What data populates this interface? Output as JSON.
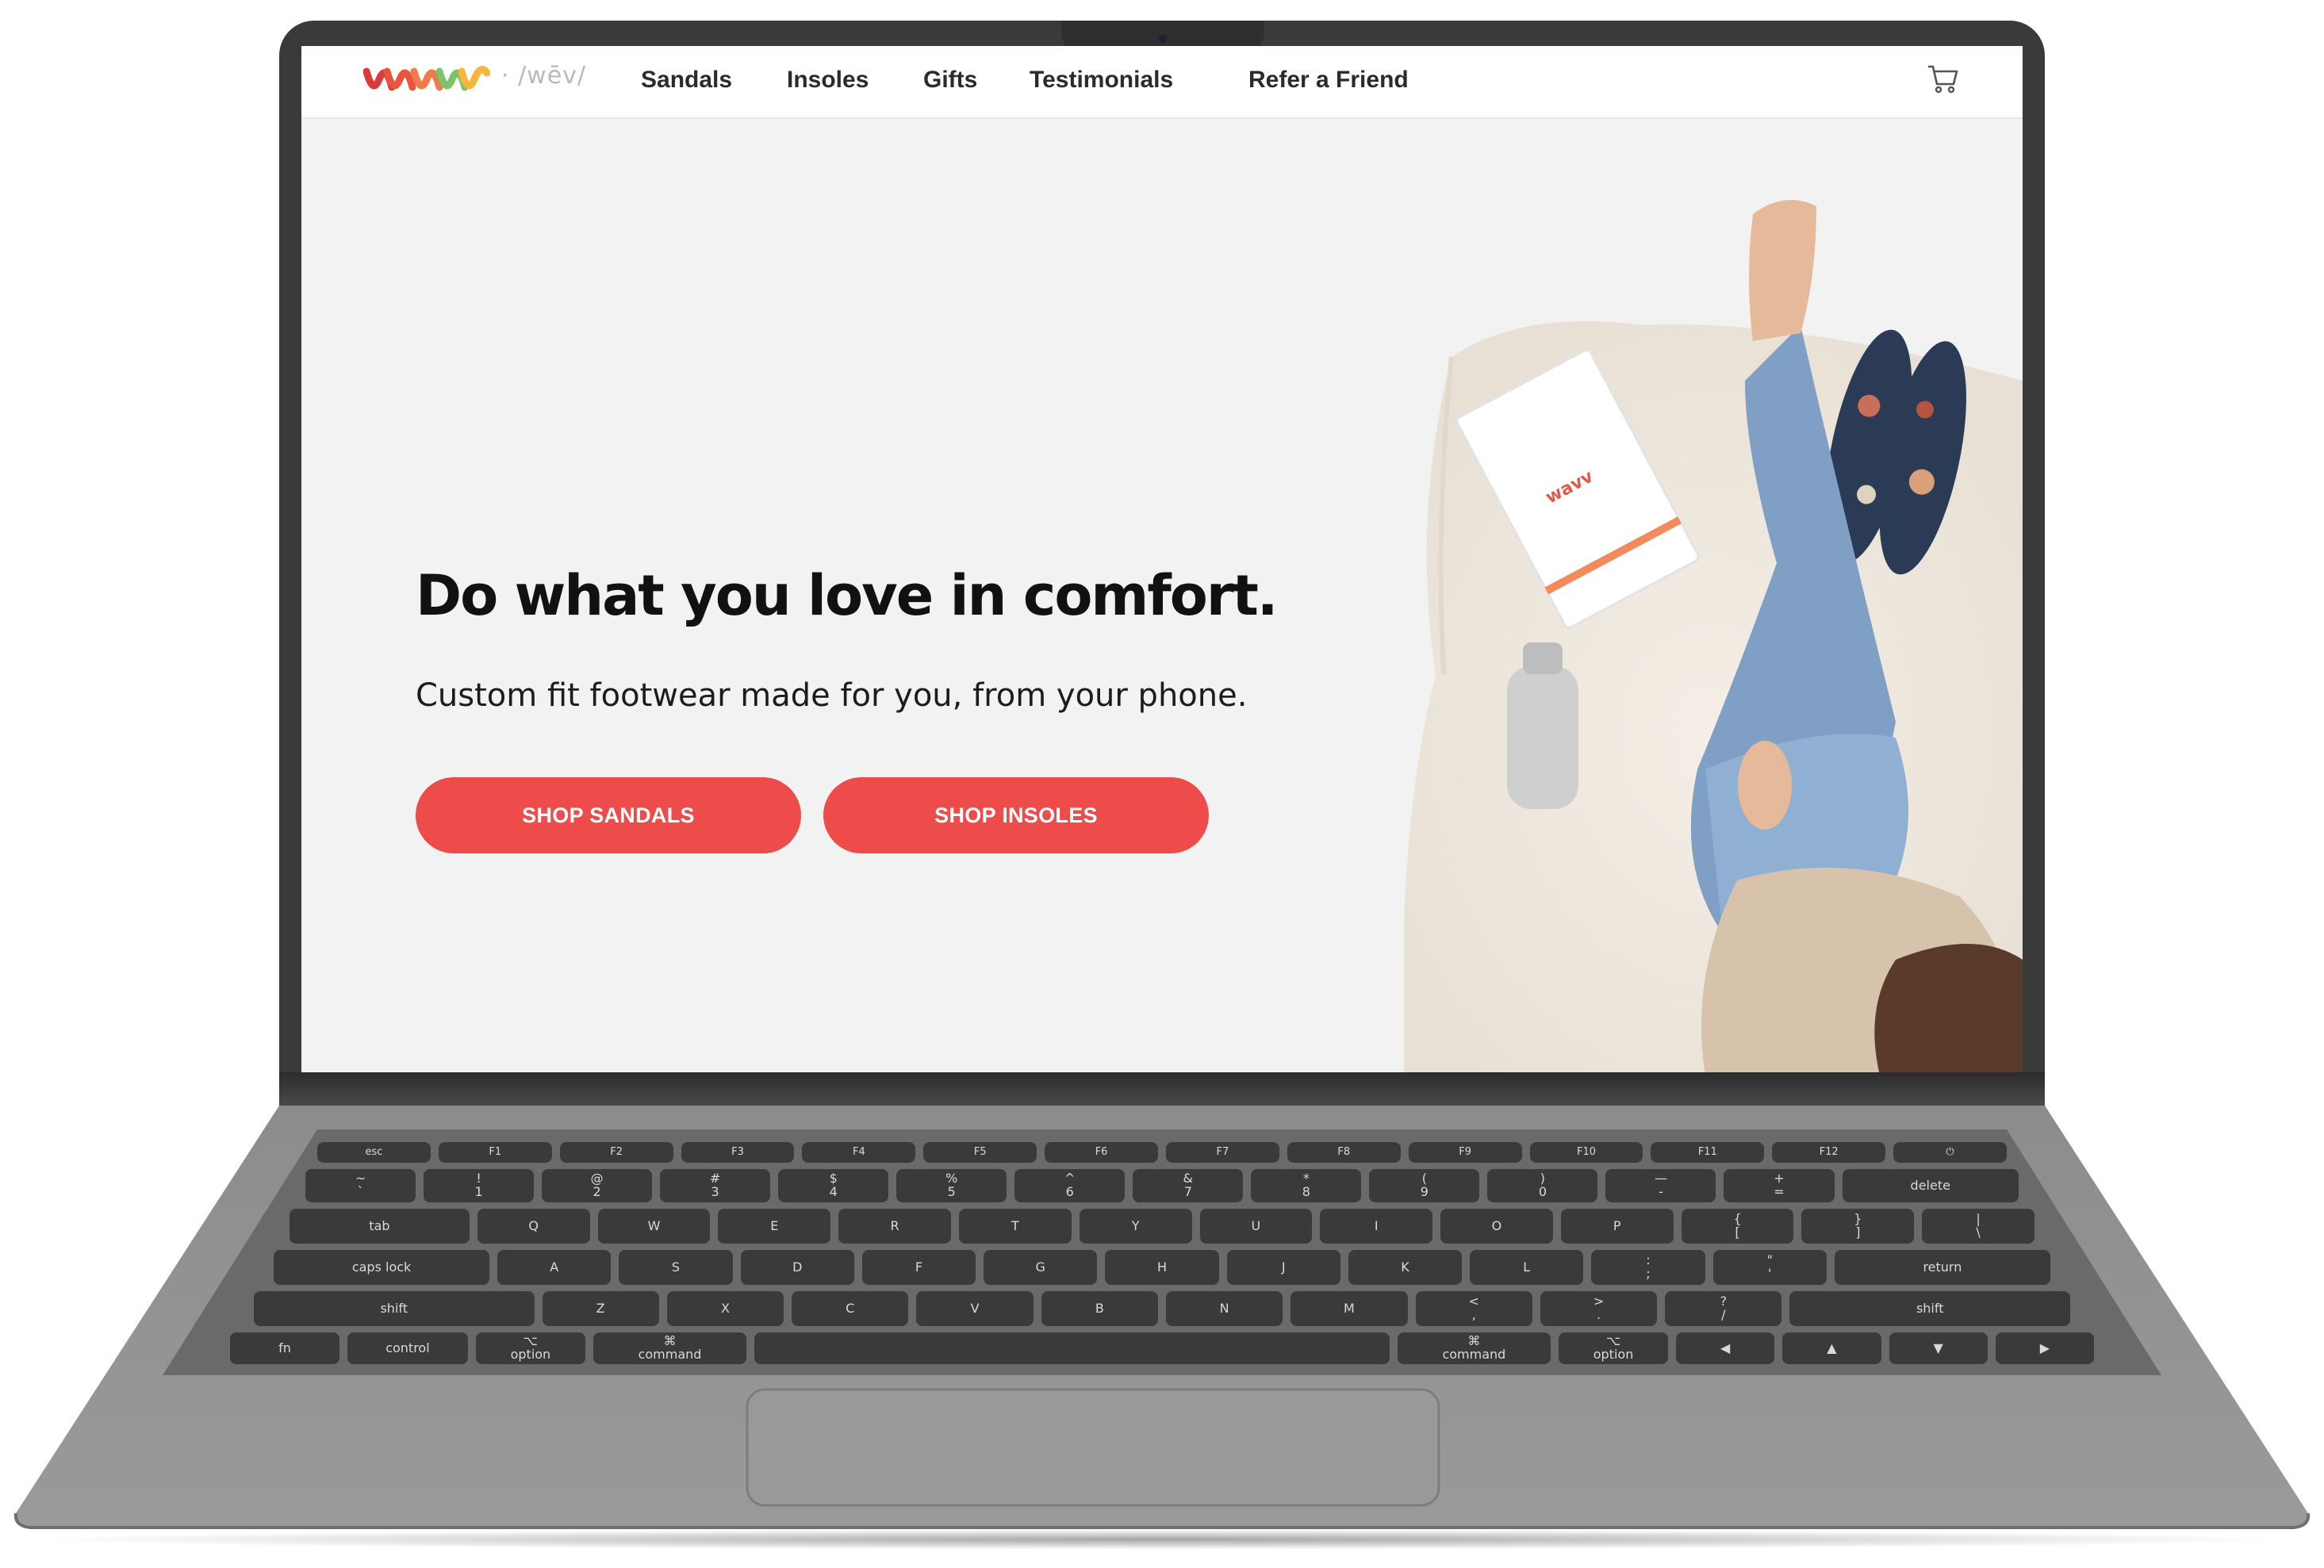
{
  "brand": {
    "logo_text": "WAVV",
    "pronunciation": "· /wēv/",
    "logo_colors": [
      "#d93a3a",
      "#f07a4a",
      "#f6b63c",
      "#7cc36b",
      "#4aa3d8"
    ]
  },
  "nav": {
    "items": [
      {
        "label": "Sandals"
      },
      {
        "label": "Insoles"
      },
      {
        "label": "Gifts"
      },
      {
        "label": "Testimonials"
      },
      {
        "label": "Refer a Friend"
      }
    ],
    "cart_icon": "cart-icon"
  },
  "hero": {
    "headline": "Do what you love in comfort.",
    "subheadline": "Custom fit footwear made for you, from your phone.",
    "buttons": [
      {
        "label": "SHOP SANDALS"
      },
      {
        "label": "SHOP INSOLES"
      }
    ],
    "photo_description_icon": "woman-on-rug-with-insoles-photo"
  },
  "keyboard": {
    "fn_row": [
      "esc",
      "F1",
      "F2",
      "F3",
      "F4",
      "F5",
      "F6",
      "F7",
      "F8",
      "F9",
      "F10",
      "F11",
      "F12",
      "⏻"
    ],
    "number_row": [
      "~\n`",
      "!\n1",
      "@\n2",
      "#\n3",
      "$\n4",
      "%\n5",
      "^\n6",
      "&\n7",
      "*\n8",
      "(\n9",
      ")\n0",
      "—\n-",
      "+\n=",
      "delete"
    ],
    "top_row": [
      "tab",
      "Q",
      "W",
      "E",
      "R",
      "T",
      "Y",
      "U",
      "I",
      "O",
      "P",
      "{\n[",
      "}\n]",
      "|\n\\"
    ],
    "home_row": [
      "caps lock",
      "A",
      "S",
      "D",
      "F",
      "G",
      "H",
      "J",
      "K",
      "L",
      ":\n;",
      "\"\n'",
      "return"
    ],
    "bottom_row": [
      "shift",
      "Z",
      "X",
      "C",
      "V",
      "B",
      "N",
      "M",
      "<\n,",
      ">\n.",
      "?\n/",
      "shift"
    ],
    "modifier_row": [
      "fn",
      "control",
      "⌥\noption",
      "⌘\ncommand",
      "",
      "⌘\ncommand",
      "⌥\noption",
      "◀",
      "▲",
      "▼",
      "▶"
    ]
  },
  "colors": {
    "accent": "#ee4b4b",
    "hero_bg": "#f2f2f2",
    "laptop_frame": "#3a3a3a",
    "laptop_body": "#8a8a8a"
  }
}
